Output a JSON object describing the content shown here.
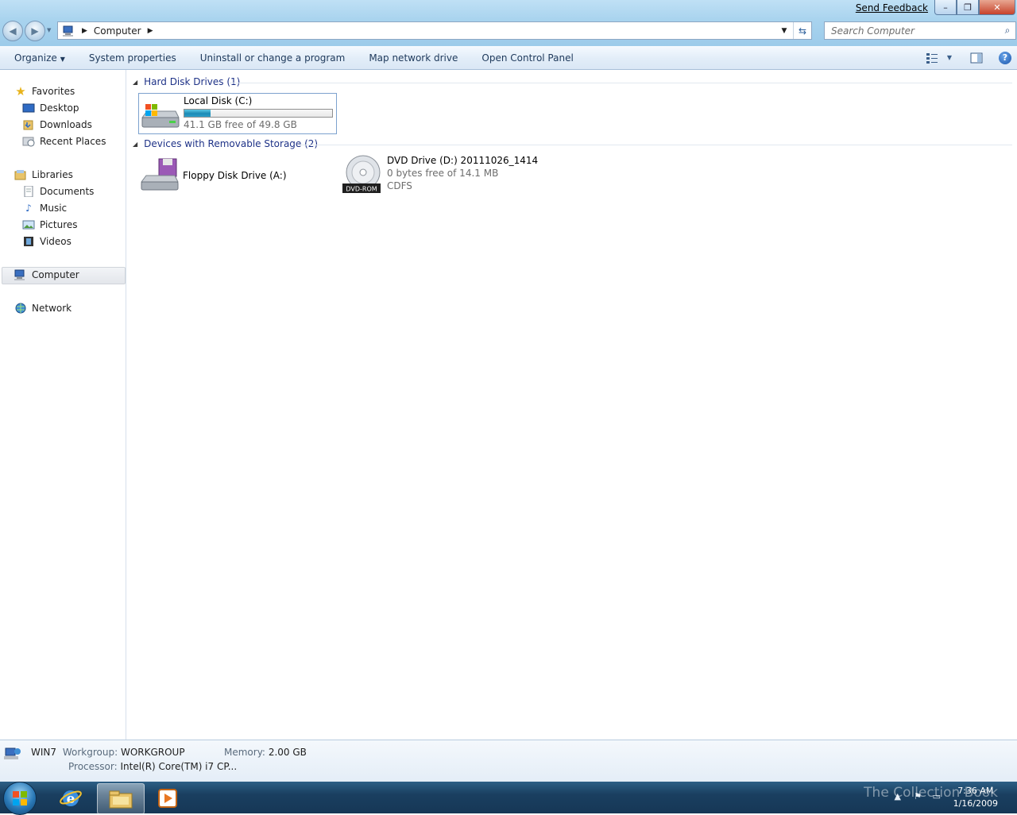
{
  "window": {
    "send_feedback": "Send Feedback",
    "minimize": "–",
    "restore": "❐",
    "close": "✕"
  },
  "address": {
    "crumb": "Computer",
    "search_placeholder": "Search Computer"
  },
  "commands": {
    "organize": "Organize",
    "system_properties": "System properties",
    "uninstall": "Uninstall or change a program",
    "map_drive": "Map network drive",
    "control_panel": "Open Control Panel",
    "help": "?"
  },
  "nav": {
    "favorites": "Favorites",
    "desktop": "Desktop",
    "downloads": "Downloads",
    "recent": "Recent Places",
    "libraries": "Libraries",
    "documents": "Documents",
    "music": "Music",
    "pictures": "Pictures",
    "videos": "Videos",
    "computer": "Computer",
    "network": "Network"
  },
  "groups": {
    "hdd": "Hard Disk Drives (1)",
    "removable": "Devices with Removable Storage (2)"
  },
  "drives": {
    "c": {
      "name": "Local Disk (C:)",
      "free": "41.1 GB free of 49.8 GB",
      "used_fraction": 0.175
    },
    "a": {
      "name": "Floppy Disk Drive (A:)"
    },
    "d": {
      "name": "DVD Drive (D:) 20111026_1414",
      "free": "0 bytes free of 14.1 MB",
      "fs": "CDFS",
      "badge": "DVD-ROM"
    }
  },
  "details": {
    "computer_name": "WIN7",
    "workgroup_label": "Workgroup:",
    "workgroup": "WORKGROUP",
    "memory_label": "Memory:",
    "memory": "2.00 GB",
    "processor_label": "Processor:",
    "processor": "Intel(R) Core(TM) i7 CP..."
  },
  "taskbar": {
    "time": "7:36 AM",
    "date": "1/16/2009",
    "watermark": "The Collection Book"
  },
  "icons": {
    "back": "back-arrow-icon",
    "forward": "forward-arrow-icon",
    "search": "magnifier-icon"
  }
}
